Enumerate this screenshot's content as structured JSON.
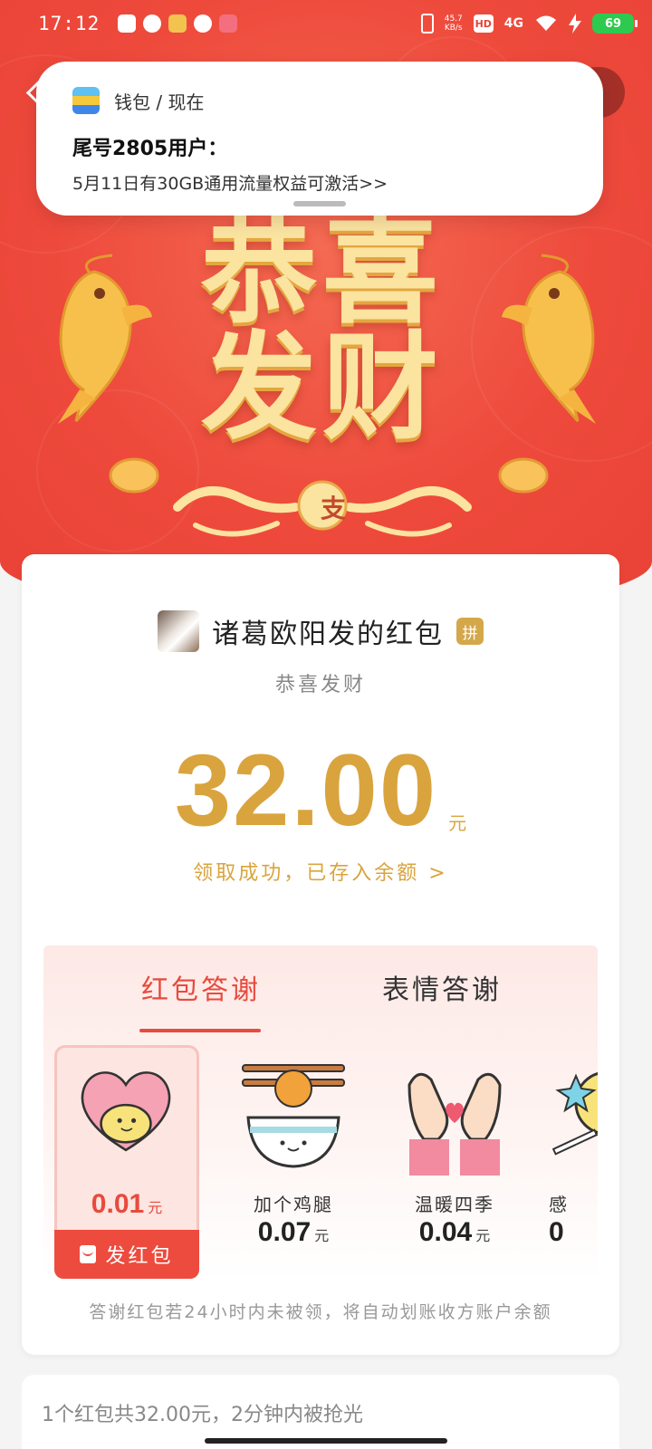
{
  "status_bar": {
    "time": "17:12",
    "net_speed": "45.7",
    "net_unit": "KB/s",
    "hd_label": "HD",
    "signal_label": "4G",
    "battery": "69"
  },
  "notification": {
    "app_name": "钱包 / 现在",
    "title": "尾号2805用户：",
    "body": "5月11日有30GB通用流量权益可激活>>"
  },
  "hero": {
    "slogan_line1": "恭喜",
    "slogan_line2": "发财",
    "seal_char": "支"
  },
  "packet": {
    "sender": "诸葛欧阳发的红包",
    "pin_badge": "拼",
    "greeting": "恭喜发财",
    "amount": "32.00",
    "unit": "元",
    "received_text": "领取成功，已存入余额 >"
  },
  "thanks": {
    "tabs": [
      {
        "label": "红包答谢"
      },
      {
        "label": "表情答谢"
      }
    ],
    "gifts": [
      {
        "name": "",
        "price": "0.01",
        "unit": "元",
        "button": "发红包"
      },
      {
        "name": "加个鸡腿",
        "price": "0.07",
        "unit": "元"
      },
      {
        "name": "温暖四季",
        "price": "0.04",
        "unit": "元"
      },
      {
        "name": "感",
        "price": "0",
        "unit": ""
      }
    ],
    "note": "答谢红包若24小时内未被领，将自动划账收方账户余额"
  },
  "summary": {
    "text": "1个红包共32.00元，2分钟内被抢光"
  },
  "colors": {
    "hero_red": "#ee4a3c",
    "gold": "#d9a43e",
    "accent_red": "#e84a3d"
  }
}
